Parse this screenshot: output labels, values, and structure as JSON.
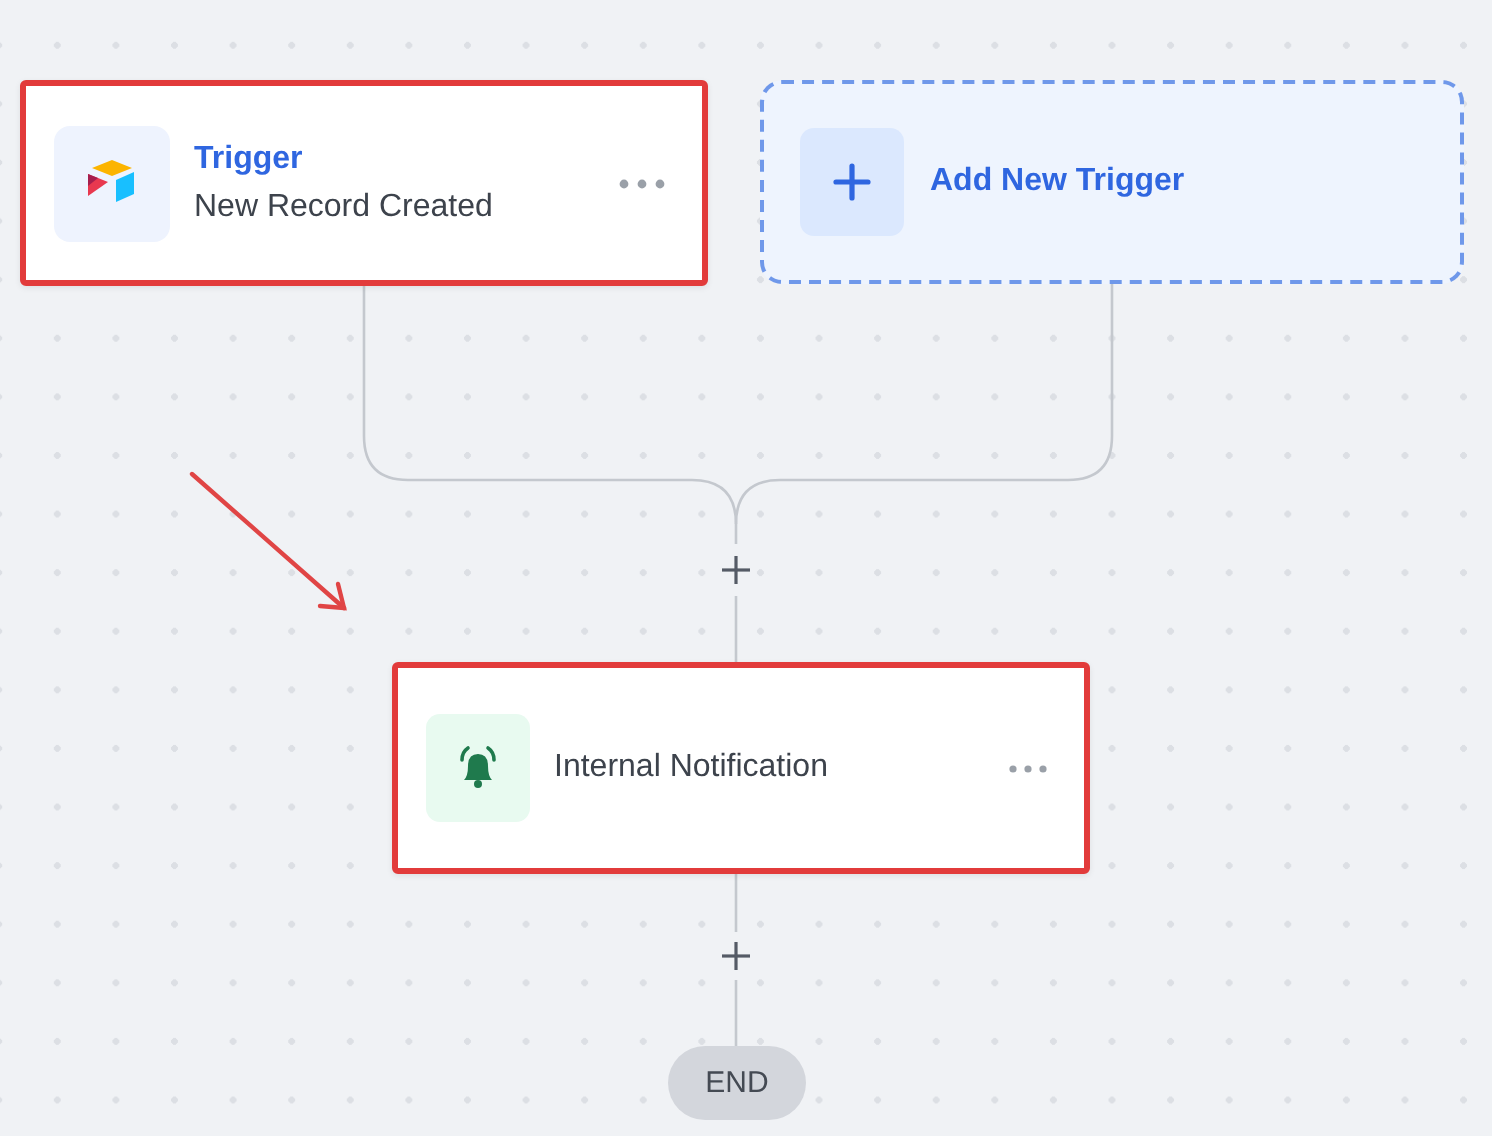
{
  "trigger": {
    "title": "Trigger",
    "subtitle": "New Record Created",
    "highlighted": true
  },
  "add_trigger": {
    "label": "Add New Trigger"
  },
  "action": {
    "label": "Internal Notification",
    "highlighted": true
  },
  "end": {
    "label": "END"
  }
}
